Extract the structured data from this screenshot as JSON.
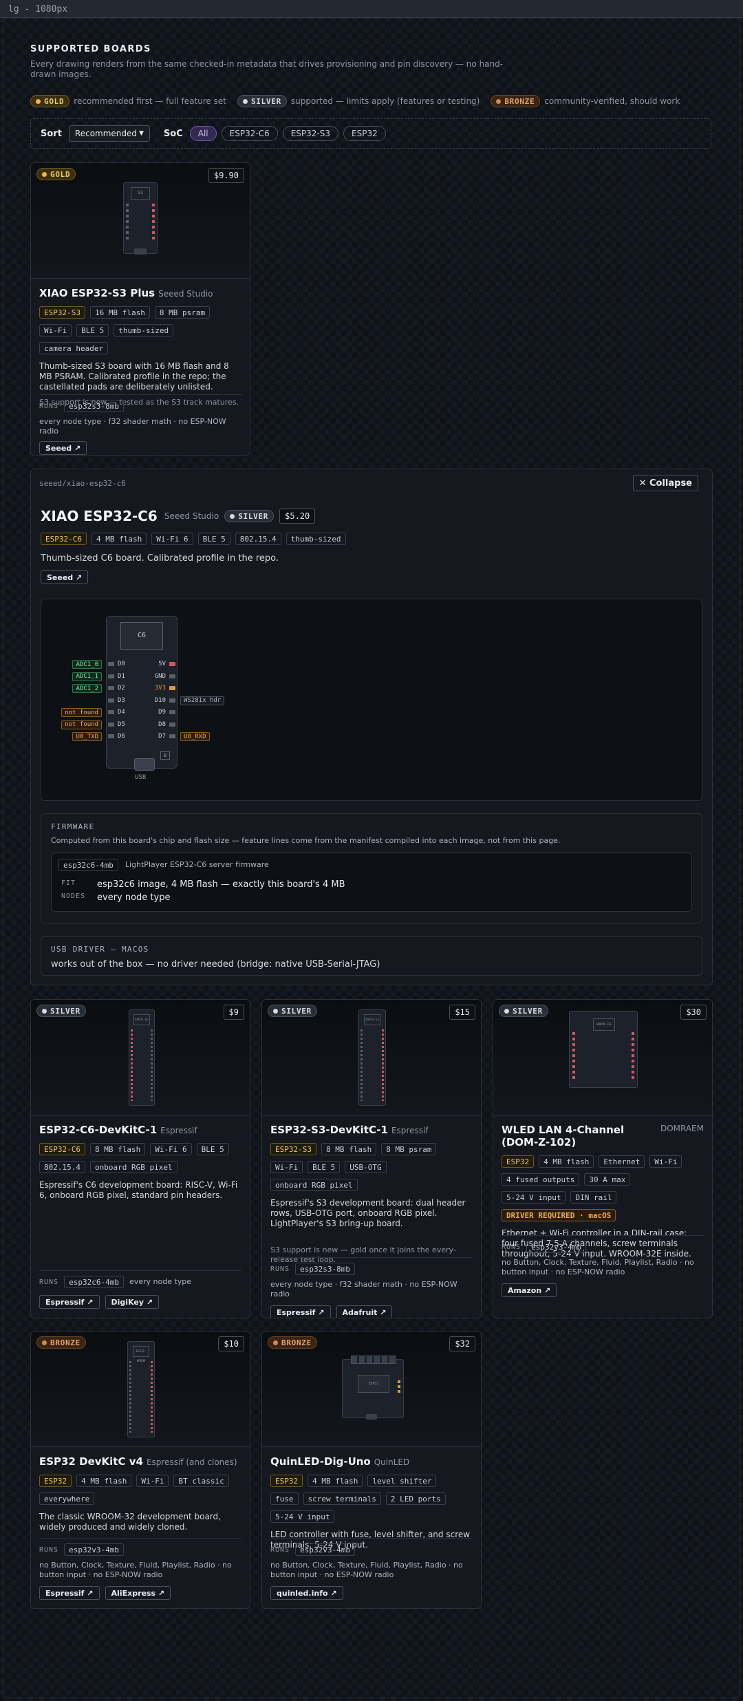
{
  "window": {
    "title": "lg - 1080px"
  },
  "header": {
    "title": "SUPPORTED BOARDS",
    "subtitle": "Every drawing renders from the same checked-in metadata that drives provisioning and pin discovery — no hand-drawn images."
  },
  "legend": [
    {
      "tier": "GOLD",
      "text": "recommended first — full feature set"
    },
    {
      "tier": "SILVER",
      "text": "supported — limits apply (features or testing)"
    },
    {
      "tier": "BRONZE",
      "text": "community-verified, should work"
    }
  ],
  "toolbar": {
    "sort_label": "Sort",
    "sort_value": "Recommended",
    "soc_label": "SoC",
    "filters": [
      "All",
      "ESP32-C6",
      "ESP32-S3",
      "ESP32"
    ]
  },
  "cards": {
    "xiao_s3": {
      "tier": "GOLD",
      "price": "$9.90",
      "chip": "S3",
      "title": "XIAO ESP32-S3 Plus",
      "vendor": "Seeed Studio",
      "tags": [
        "ESP32-S3",
        "16 MB flash",
        "8 MB psram",
        "Wi-Fi",
        "BLE 5",
        "thumb-sized",
        "camera header"
      ],
      "desc": "Thumb-sized S3 board with 16 MB flash and 8 MB PSRAM. Calibrated profile in the repo; the castellated pads are deliberately unlisted.",
      "note": "S3 support is new — tested as the S3 track matures.",
      "runs_label": "RUNS",
      "runs": "esp32s3-8mb",
      "runs_note": "every node type · f32 shader math · no ESP-NOW radio",
      "links": [
        "Seeed ↗"
      ]
    },
    "c6_devkit": {
      "tier": "SILVER",
      "price": "$9",
      "chip": "ESP32-C6",
      "title": "ESP32-C6-DevKitC-1",
      "vendor": "Espressif",
      "tags": [
        "ESP32-C6",
        "8 MB flash",
        "Wi-Fi 6",
        "BLE 5",
        "802.15.4",
        "onboard RGB pixel"
      ],
      "desc": "Espressif's C6 development board: RISC-V, Wi-Fi 6, onboard RGB pixel, standard pin headers.",
      "runs_label": "RUNS",
      "runs": "esp32c6-4mb",
      "runs_note": "every node type",
      "links": [
        "Espressif ↗",
        "DigiKey ↗"
      ]
    },
    "s3_devkit": {
      "tier": "SILVER",
      "price": "$15",
      "chip": "ESP32-S3",
      "title": "ESP32-S3-DevKitC-1",
      "vendor": "Espressif",
      "tags": [
        "ESP32-S3",
        "8 MB flash",
        "8 MB psram",
        "Wi-Fi",
        "BLE 5",
        "USB-OTG",
        "onboard RGB pixel"
      ],
      "desc": "Espressif's S3 development board: dual header rows, USB-OTG port, onboard RGB pixel. LightPlayer's S3 bring-up board.",
      "note": "S3 support is new — gold once it joins the every-release test loop.",
      "runs_label": "RUNS",
      "runs": "esp32s3-8mb",
      "runs_note": "every node type · f32 shader math · no ESP-NOW radio",
      "links": [
        "Espressif ↗",
        "Adafruit ↗"
      ]
    },
    "wled": {
      "tier": "SILVER",
      "price": "$30",
      "chip": "WROOM-32E",
      "title": "WLED LAN 4-Channel (DOM-Z-102)",
      "vendor": "DOMRAEM",
      "tags": [
        "ESP32",
        "4 MB flash",
        "Ethernet",
        "Wi-Fi",
        "4 fused outputs",
        "30 A max",
        "5-24 V input",
        "DIN rail",
        "DRIVER REQUIRED · macOS"
      ],
      "desc": "Ethernet + Wi-Fi controller in a DIN-rail case: four fused 7.5 A channels, screw terminals throughout, 5-24 V input. WROOM-32E inside.",
      "runs_label": "RUNS",
      "runs": "esp32v3-4mb",
      "runs_note": "no Button, Clock, Texture, Fluid, Playlist, Radio · no button input · no ESP-NOW radio",
      "links": [
        "Amazon ↗"
      ]
    },
    "devkit_v4": {
      "tier": "BRONZE",
      "price": "$10",
      "chip": "ESP32-WROOM",
      "title": "ESP32 DevKitC v4",
      "vendor": "Espressif (and clones)",
      "tags": [
        "ESP32",
        "4 MB flash",
        "Wi-Fi",
        "BT classic",
        "everywhere"
      ],
      "desc": "The classic WROOM-32 development board, widely produced and widely cloned.",
      "runs_label": "RUNS",
      "runs": "esp32v3-4mb",
      "runs_note": "no Button, Clock, Texture, Fluid, Playlist, Radio · no button input · no ESP-NOW radio",
      "links": [
        "Espressif ↗",
        "AliExpress ↗"
      ]
    },
    "quinled": {
      "tier": "BRONZE",
      "price": "$32",
      "chip": "ESP32",
      "title": "QuinLED-Dig-Uno",
      "vendor": "QuinLED",
      "tags": [
        "ESP32",
        "4 MB flash",
        "level shifter",
        "fuse",
        "screw terminals",
        "2 LED ports",
        "5-24 V input"
      ],
      "desc": "LED controller with fuse, level shifter, and screw terminals; 5-24 V input.",
      "runs_label": "RUNS",
      "runs": "esp32v3-4mb",
      "runs_note": "no Button, Clock, Texture, Fluid, Playlist, Radio · no button input · no ESP-NOW radio",
      "links": [
        "quinled.info ↗"
      ]
    }
  },
  "detail": {
    "path": "seeed/xiao-esp32-c6",
    "collapse": "✕ Collapse",
    "title": "XIAO ESP32-C6",
    "vendor": "Seeed Studio",
    "tier": "SILVER",
    "price": "$5.20",
    "tags": [
      "ESP32-C6",
      "4 MB flash",
      "Wi-Fi 6",
      "BLE 5",
      "802.15.4",
      "thumb-sized"
    ],
    "desc": "Thumb-sized C6 board. Calibrated profile in the repo.",
    "link": "Seeed ↗",
    "diagram": {
      "chip": "C6",
      "usb": "USB",
      "boot": "B",
      "left_pins": [
        {
          "pin": "D0",
          "label": "ADC1_0",
          "kind": "g"
        },
        {
          "pin": "D1",
          "label": "ADC1_1",
          "kind": "g"
        },
        {
          "pin": "D2",
          "label": "ADC1_2",
          "kind": "g"
        },
        {
          "pin": "D3",
          "label": "",
          "kind": ""
        },
        {
          "pin": "D4",
          "label": "not found",
          "kind": "o"
        },
        {
          "pin": "D5",
          "label": "not found",
          "kind": "o"
        },
        {
          "pin": "D6",
          "label": "U0_TXD",
          "kind": "o"
        }
      ],
      "right_pins": [
        {
          "pin": "5V",
          "label": "",
          "kind": "",
          "pad": "#d0595a"
        },
        {
          "pin": "GND",
          "label": "",
          "kind": "",
          "pad": "#5a606b"
        },
        {
          "pin": "3V3",
          "label": "",
          "kind": "",
          "pad": "#d99a3c"
        },
        {
          "pin": "D10",
          "label": "WS281x hdr",
          "kind": "n",
          "pad": "#5a606b"
        },
        {
          "pin": "D9",
          "label": "",
          "kind": "",
          "pad": "#5a606b"
        },
        {
          "pin": "D8",
          "label": "",
          "kind": "",
          "pad": "#5a606b"
        },
        {
          "pin": "D7",
          "label": "U0_RXD",
          "kind": "o",
          "pad": "#5a606b"
        }
      ]
    },
    "firmware": {
      "label": "FIRMWARE",
      "desc": "Computed from this board's chip and flash size — feature lines come from the manifest compiled into each image, not from this page.",
      "image": "esp32c6-4mb",
      "image_desc": "LightPlayer ESP32-C6 server firmware",
      "fit_label": "FIT",
      "fit": "esp32c6 image, 4 MB flash — exactly this board's 4 MB",
      "nodes_label": "NODES",
      "nodes": "every node type"
    },
    "driver": {
      "label": "USB DRIVER — MACOS",
      "text": "works out of the box — no driver needed (bridge: native USB-Serial-JTAG)"
    }
  }
}
